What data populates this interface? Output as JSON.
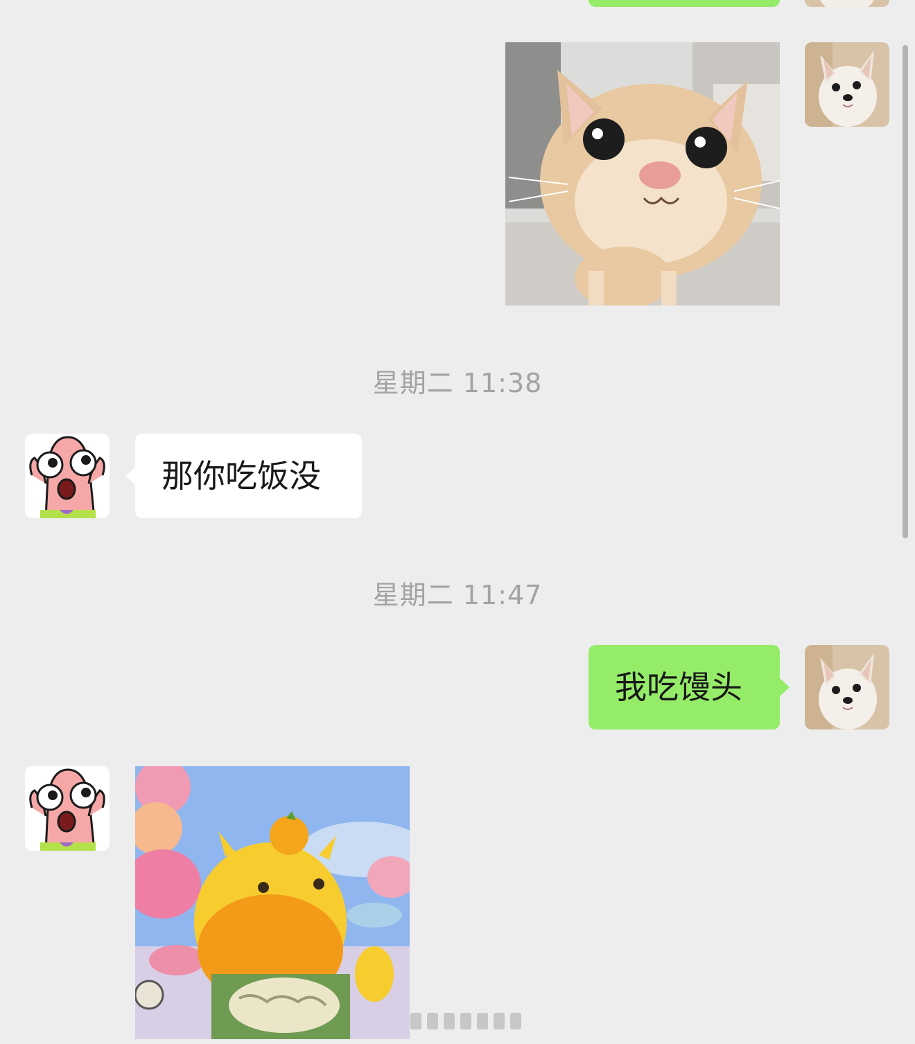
{
  "messages": {
    "timestamp_1": "星期二 11:38",
    "incoming_text": "那你吃饭没",
    "timestamp_2": "星期二 11:47",
    "outgoing_text": "我吃馒头"
  },
  "colors": {
    "background": "#ededed",
    "incoming_bubble": "#ffffff",
    "outgoing_bubble": "#95ec69",
    "timestamp_text": "#a3a3a3",
    "message_text": "#191919"
  },
  "icons": {
    "self_avatar": "puppy-avatar",
    "contact_avatar": "patrick-star-avatar",
    "sticker_1": "kitten-sticker",
    "sticker_2": "yellow-duck-sticker"
  }
}
